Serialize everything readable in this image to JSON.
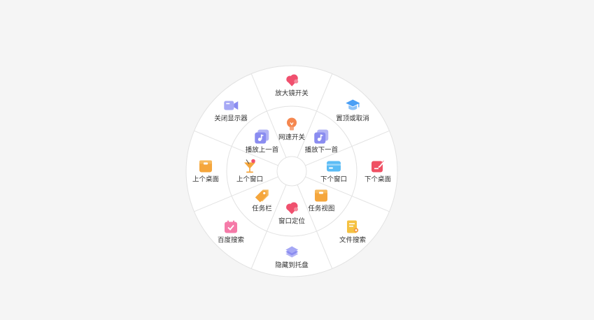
{
  "outer_items": [
    {
      "id": "magnifier",
      "label": "放大镜开关",
      "icon": "heart-cloud-icon",
      "color": "#f0506e"
    },
    {
      "id": "pin-toggle",
      "label": "置顶或取消",
      "icon": "graduation-cap-icon",
      "color": "#4a9ff5"
    },
    {
      "id": "next-desktop",
      "label": "下个桌面",
      "icon": "edit-note-icon",
      "color": "#ef5063"
    },
    {
      "id": "file-search",
      "label": "文件搜索",
      "icon": "document-search-icon",
      "color": "#f5c242"
    },
    {
      "id": "hide-to-tray",
      "label": "隐藏到托盘",
      "icon": "layers-icon",
      "color": "#8a8cf0"
    },
    {
      "id": "baidu-search",
      "label": "百度搜索",
      "icon": "calendar-check-icon",
      "color": "#f57aa8"
    },
    {
      "id": "prev-desktop",
      "label": "上个桌面",
      "icon": "folder-box-icon",
      "color": "#f5a63c"
    },
    {
      "id": "close-display",
      "label": "关闭显示器",
      "icon": "video-camera-icon",
      "color": "#8a8cf0"
    }
  ],
  "inner_items": [
    {
      "id": "net-speed",
      "label": "网速开关",
      "icon": "lightbulb-icon",
      "color": "#f5874f"
    },
    {
      "id": "play-next",
      "label": "播放下一首",
      "icon": "music-next-icon",
      "color": "#8a8cf0"
    },
    {
      "id": "next-window",
      "label": "下个窗口",
      "icon": "credit-card-icon",
      "color": "#5bbcf5"
    },
    {
      "id": "task-view",
      "label": "任务视图",
      "icon": "folder-box-icon",
      "color": "#f5a63c"
    },
    {
      "id": "window-locate",
      "label": "窗口定位",
      "icon": "heart-cloud-icon",
      "color": "#f0506e"
    },
    {
      "id": "taskbar",
      "label": "任务栏",
      "icon": "tag-icon",
      "color": "#f5a63c"
    },
    {
      "id": "prev-window",
      "label": "上个窗口",
      "icon": "cocktail-icon",
      "color": "#f5a63c"
    },
    {
      "id": "play-prev",
      "label": "播放上一首",
      "icon": "music-prev-icon",
      "color": "#8a8cf0"
    }
  ]
}
